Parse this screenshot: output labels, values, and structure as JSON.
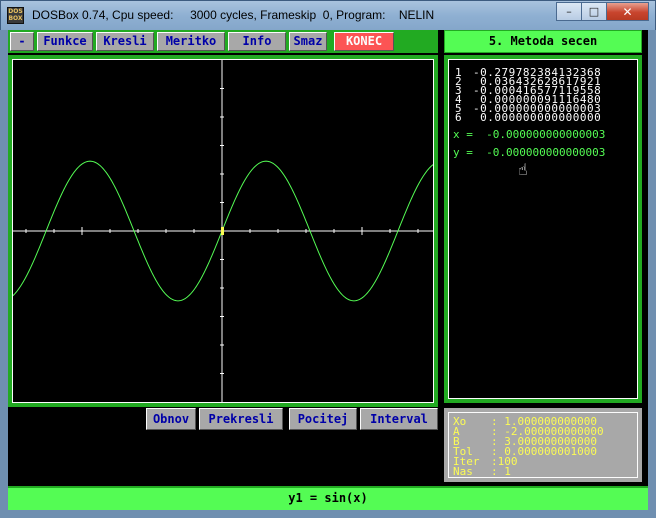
{
  "window": {
    "title": "DOSBox 0.74, Cpu speed:     3000 cycles, Frameskip  0, Program:    NELIN",
    "icon_label": "DOS BOX",
    "minimize": "–",
    "maximize": "□",
    "close": "✕"
  },
  "menu": {
    "items": [
      {
        "label": "-"
      },
      {
        "label": "Funkce"
      },
      {
        "label": "Kresli"
      },
      {
        "label": "Meritko"
      },
      {
        "label": "Info"
      },
      {
        "label": "Smaz"
      },
      {
        "label": "KONEC"
      }
    ]
  },
  "method_title": "5. Metoda secen",
  "graph": {
    "function": "sin(x)",
    "x_range": [
      -7.5,
      7.5
    ],
    "y_range": [
      -6,
      6
    ],
    "colors": {
      "curve": "#54fc54",
      "axis": "#fcfcfc",
      "marker": "#fcfc54"
    }
  },
  "iterations": [
    {
      "n": "1",
      "value": "-0.279782384132368"
    },
    {
      "n": "2",
      "value": " 0.036432628617921"
    },
    {
      "n": "3",
      "value": "-0.000416577119558"
    },
    {
      "n": "4",
      "value": " 0.000000091116480"
    },
    {
      "n": "5",
      "value": "-0.000000000000003"
    },
    {
      "n": "6",
      "value": " 0.000000000000000"
    }
  ],
  "result": {
    "x": "x =  -0.000000000000003",
    "y": "y =  -0.000000000000003"
  },
  "actions": [
    {
      "label": "Obnov"
    },
    {
      "label": "Prekresli"
    },
    {
      "label": "Pocitej"
    },
    {
      "label": "Interval"
    }
  ],
  "params": [
    {
      "key": "Xo",
      "value": ": 1.000000000000"
    },
    {
      "key": "A",
      "value": ": -2.000000000000"
    },
    {
      "key": "B",
      "value": ": 3.000000000000"
    },
    {
      "key": "Tol",
      "value": ": 0.000000001000"
    },
    {
      "key": "Iter",
      "value": ":100"
    },
    {
      "key": "Nas",
      "value": ": 1"
    }
  ],
  "function_bar": "y1 = sin(x)",
  "pointer_icon": "hand-pointer-icon"
}
